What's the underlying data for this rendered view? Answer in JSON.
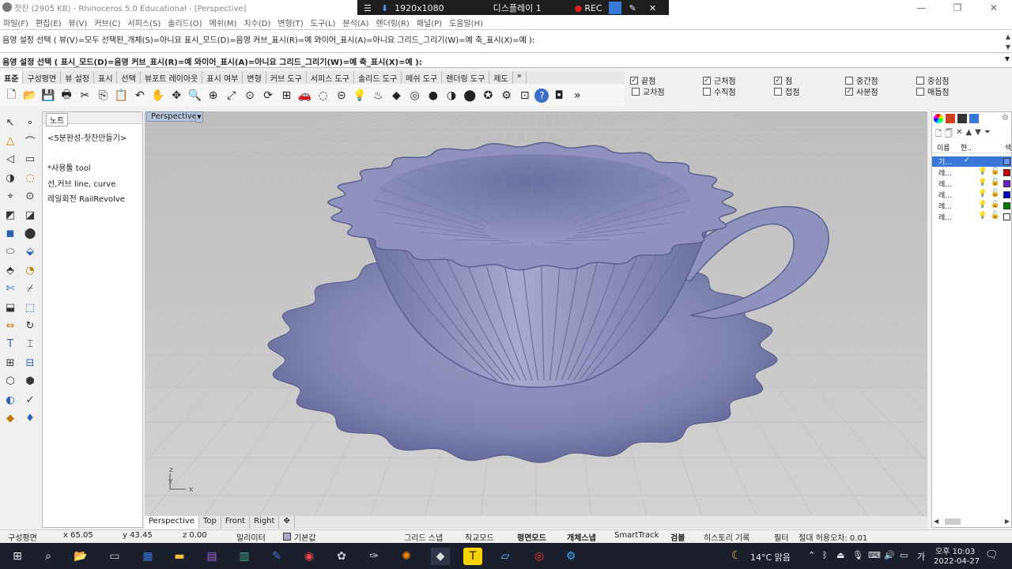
{
  "window": {
    "title": "찻잔 (2905 KB) - Rhinoceros 5.0 Educational - [Perspective]",
    "controls": [
      "—",
      "❐",
      "✕"
    ]
  },
  "recorder": {
    "resolution": "1920x1080",
    "display": "디스플레이 1",
    "rec": "REC"
  },
  "menu": [
    "파일(F)",
    "편집(E)",
    "뷰(V)",
    "커브(C)",
    "서피스(S)",
    "솔리드(O)",
    "메쉬(M)",
    "치수(D)",
    "변형(T)",
    "도구(L)",
    "분석(A)",
    "렌더링(R)",
    "패널(P)",
    "도움말(H)"
  ],
  "command": {
    "history": "음영 설정 선택 ( 뷰(V)=모두  선택된_개체(S)=아니요  표시_모드(D)=음영  커브_표시(R)=예  와이어_표시(A)=아니요  그리드_그리기(W)=예  축_표시(X)=예 ):",
    "prompt": "음영 설정 선택 ( 표시_모드(D)=음영  커브_표시(R)=예  와이어_표시(A)=아니요  그리드_그리기(W)=예  축_표시(X)=예 ):"
  },
  "tabs": [
    "표준",
    "구성평면",
    "뷰 설정",
    "표시",
    "선택",
    "뷰포트 레이아웃",
    "표시 여부",
    "변형",
    "커브 도구",
    "서피스 도구",
    "솔리드 도구",
    "메쉬 도구",
    "렌더링 도구",
    "제도",
    "»"
  ],
  "toolbar_icons": [
    "new-icon",
    "open-icon",
    "save-icon",
    "print-icon",
    "cut-icon",
    "copy-icon",
    "paste-icon",
    "undo-icon",
    "pan-icon",
    "move-view-icon",
    "zoom-icon",
    "zoom-window-icon",
    "zoom-extents-icon",
    "zoom-selected-icon",
    "rotate-view-icon",
    "four-view-icon",
    "car-icon",
    "hide-icon",
    "camera-icon",
    "bulb-icon",
    "lamp-icon",
    "material-icon",
    "color-wheel-icon",
    "sphere-icon",
    "sphere-shade-icon",
    "render-sphere-icon",
    "rhino-icon",
    "settings-icon",
    "cut-tool-icon",
    "help-icon",
    "plugin-icon"
  ],
  "osnap": [
    {
      "label": "끝점",
      "checked": true
    },
    {
      "label": "근처점",
      "checked": true
    },
    {
      "label": "점",
      "checked": true
    },
    {
      "label": "중간점",
      "checked": false
    },
    {
      "label": "중심점",
      "checked": false
    },
    {
      "label": "교차점",
      "checked": false
    },
    {
      "label": "수직점",
      "checked": false
    },
    {
      "label": "접점",
      "checked": false
    },
    {
      "label": "사분점",
      "checked": true
    },
    {
      "label": "매듭점",
      "checked": false
    }
  ],
  "notes": {
    "tab": "노트",
    "lines": [
      "<5분완성-찻잔만들기>",
      "",
      "*사용툴 tool",
      "선,커브 line, curve",
      "레일회전 RailRevolve"
    ]
  },
  "viewport": {
    "label": "Perspective",
    "axes": {
      "z": "z",
      "y": "y",
      "x": "x"
    }
  },
  "viewtabs": [
    "Perspective",
    "Top",
    "Front",
    "Right",
    "✥"
  ],
  "layers": {
    "header": [
      "이름",
      "현..",
      "색"
    ],
    "rows": [
      {
        "name": "기...",
        "color": "#6699ff",
        "current": true
      },
      {
        "name": "레...",
        "color": "#cc0000"
      },
      {
        "name": "레...",
        "color": "#6a22cc"
      },
      {
        "name": "레...",
        "color": "#0000cc"
      },
      {
        "name": "레...",
        "color": "#007700"
      },
      {
        "name": "레...",
        "color": "#ffffff"
      }
    ]
  },
  "status": {
    "cplane": "구성평면",
    "x": "x 65.05",
    "y": "y 43.45",
    "z": "z 0.00",
    "unit": "밀리미터",
    "layer": "기본값",
    "grid": "그리드 스냅",
    "ortho": "직교모드",
    "planar": "평면모드",
    "osnap": "개체스냅",
    "smart": "SmartTrack",
    "gumball": "검볼",
    "history": "히스토리 기록",
    "filter": "필터",
    "tolerance": "절대 허용오차: 0.01"
  },
  "taskbar": {
    "weather": "14°C 맑음",
    "time": "오후 10:03",
    "date": "2022-04-27",
    "ime": "가"
  },
  "colors": {
    "cup": "#8e92bc",
    "accent": "#3a78d8"
  }
}
